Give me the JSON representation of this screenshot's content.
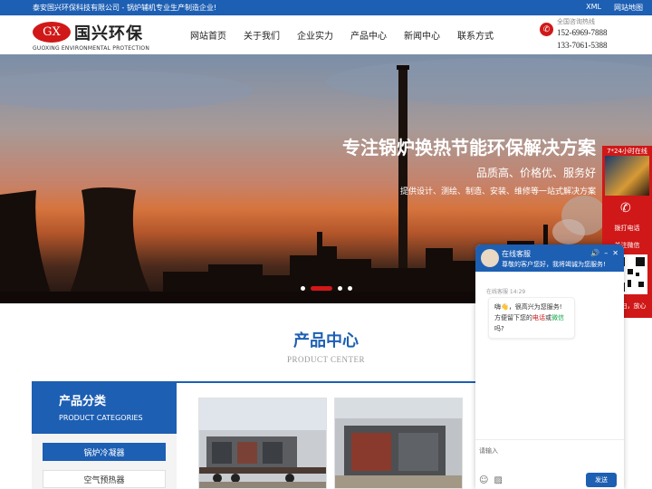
{
  "topbar": {
    "tagline": "泰安国兴环保科技有限公司 - 锅炉辅机专业生产制造企业!",
    "links": [
      "XML",
      "网站地图"
    ]
  },
  "header": {
    "logo_mark": "GX",
    "logo_cn": "国兴环保",
    "logo_en": "GUOXING ENVIRONMENTAL PROTECTION",
    "nav": [
      "网站首页",
      "关于我们",
      "企业实力",
      "产品中心",
      "新闻中心",
      "联系方式"
    ],
    "hotline_label": "全国咨询热线",
    "phone1": "152-6969-7888",
    "phone2": "133-7061-5388"
  },
  "banner": {
    "slogan": "专注锅炉换热节能环保解决方案",
    "sub1": "品质高、价格优、服务好",
    "sub2": "提供设计、测绘、制造、安装、维修等一站式解决方案",
    "slide_count": 4,
    "active_slide": 2
  },
  "products": {
    "title": "产品中心",
    "subtitle": "PRODUCT CENTER",
    "category_title": "产品分类",
    "category_subtitle": "PRODUCT CATEGORIES",
    "categories": [
      "锅炉冷凝器",
      "空气预热器"
    ]
  },
  "float_service": {
    "online": "7*24小时在线",
    "call": "拨打电话",
    "wechat": "关注微信",
    "scan": "扫一扫，放心"
  },
  "chat": {
    "agent_name": "在线客服",
    "greeting": "尊敬的客户您好，我将竭诚为您服务!",
    "message_meta": "在线客服 14:29",
    "msg_line1_emoji": "嗨👋",
    "msg_line1": "，很高兴为您服务!",
    "msg_line2_a": "方便留下您的",
    "msg_hl1": "电话",
    "msg_mid": "或",
    "msg_hl2": "微信",
    "msg_end": "吗?",
    "input_placeholder": "请输入",
    "send_label": "发送"
  },
  "colors": {
    "brand_blue": "#1d5fb3",
    "brand_red": "#d01818"
  }
}
